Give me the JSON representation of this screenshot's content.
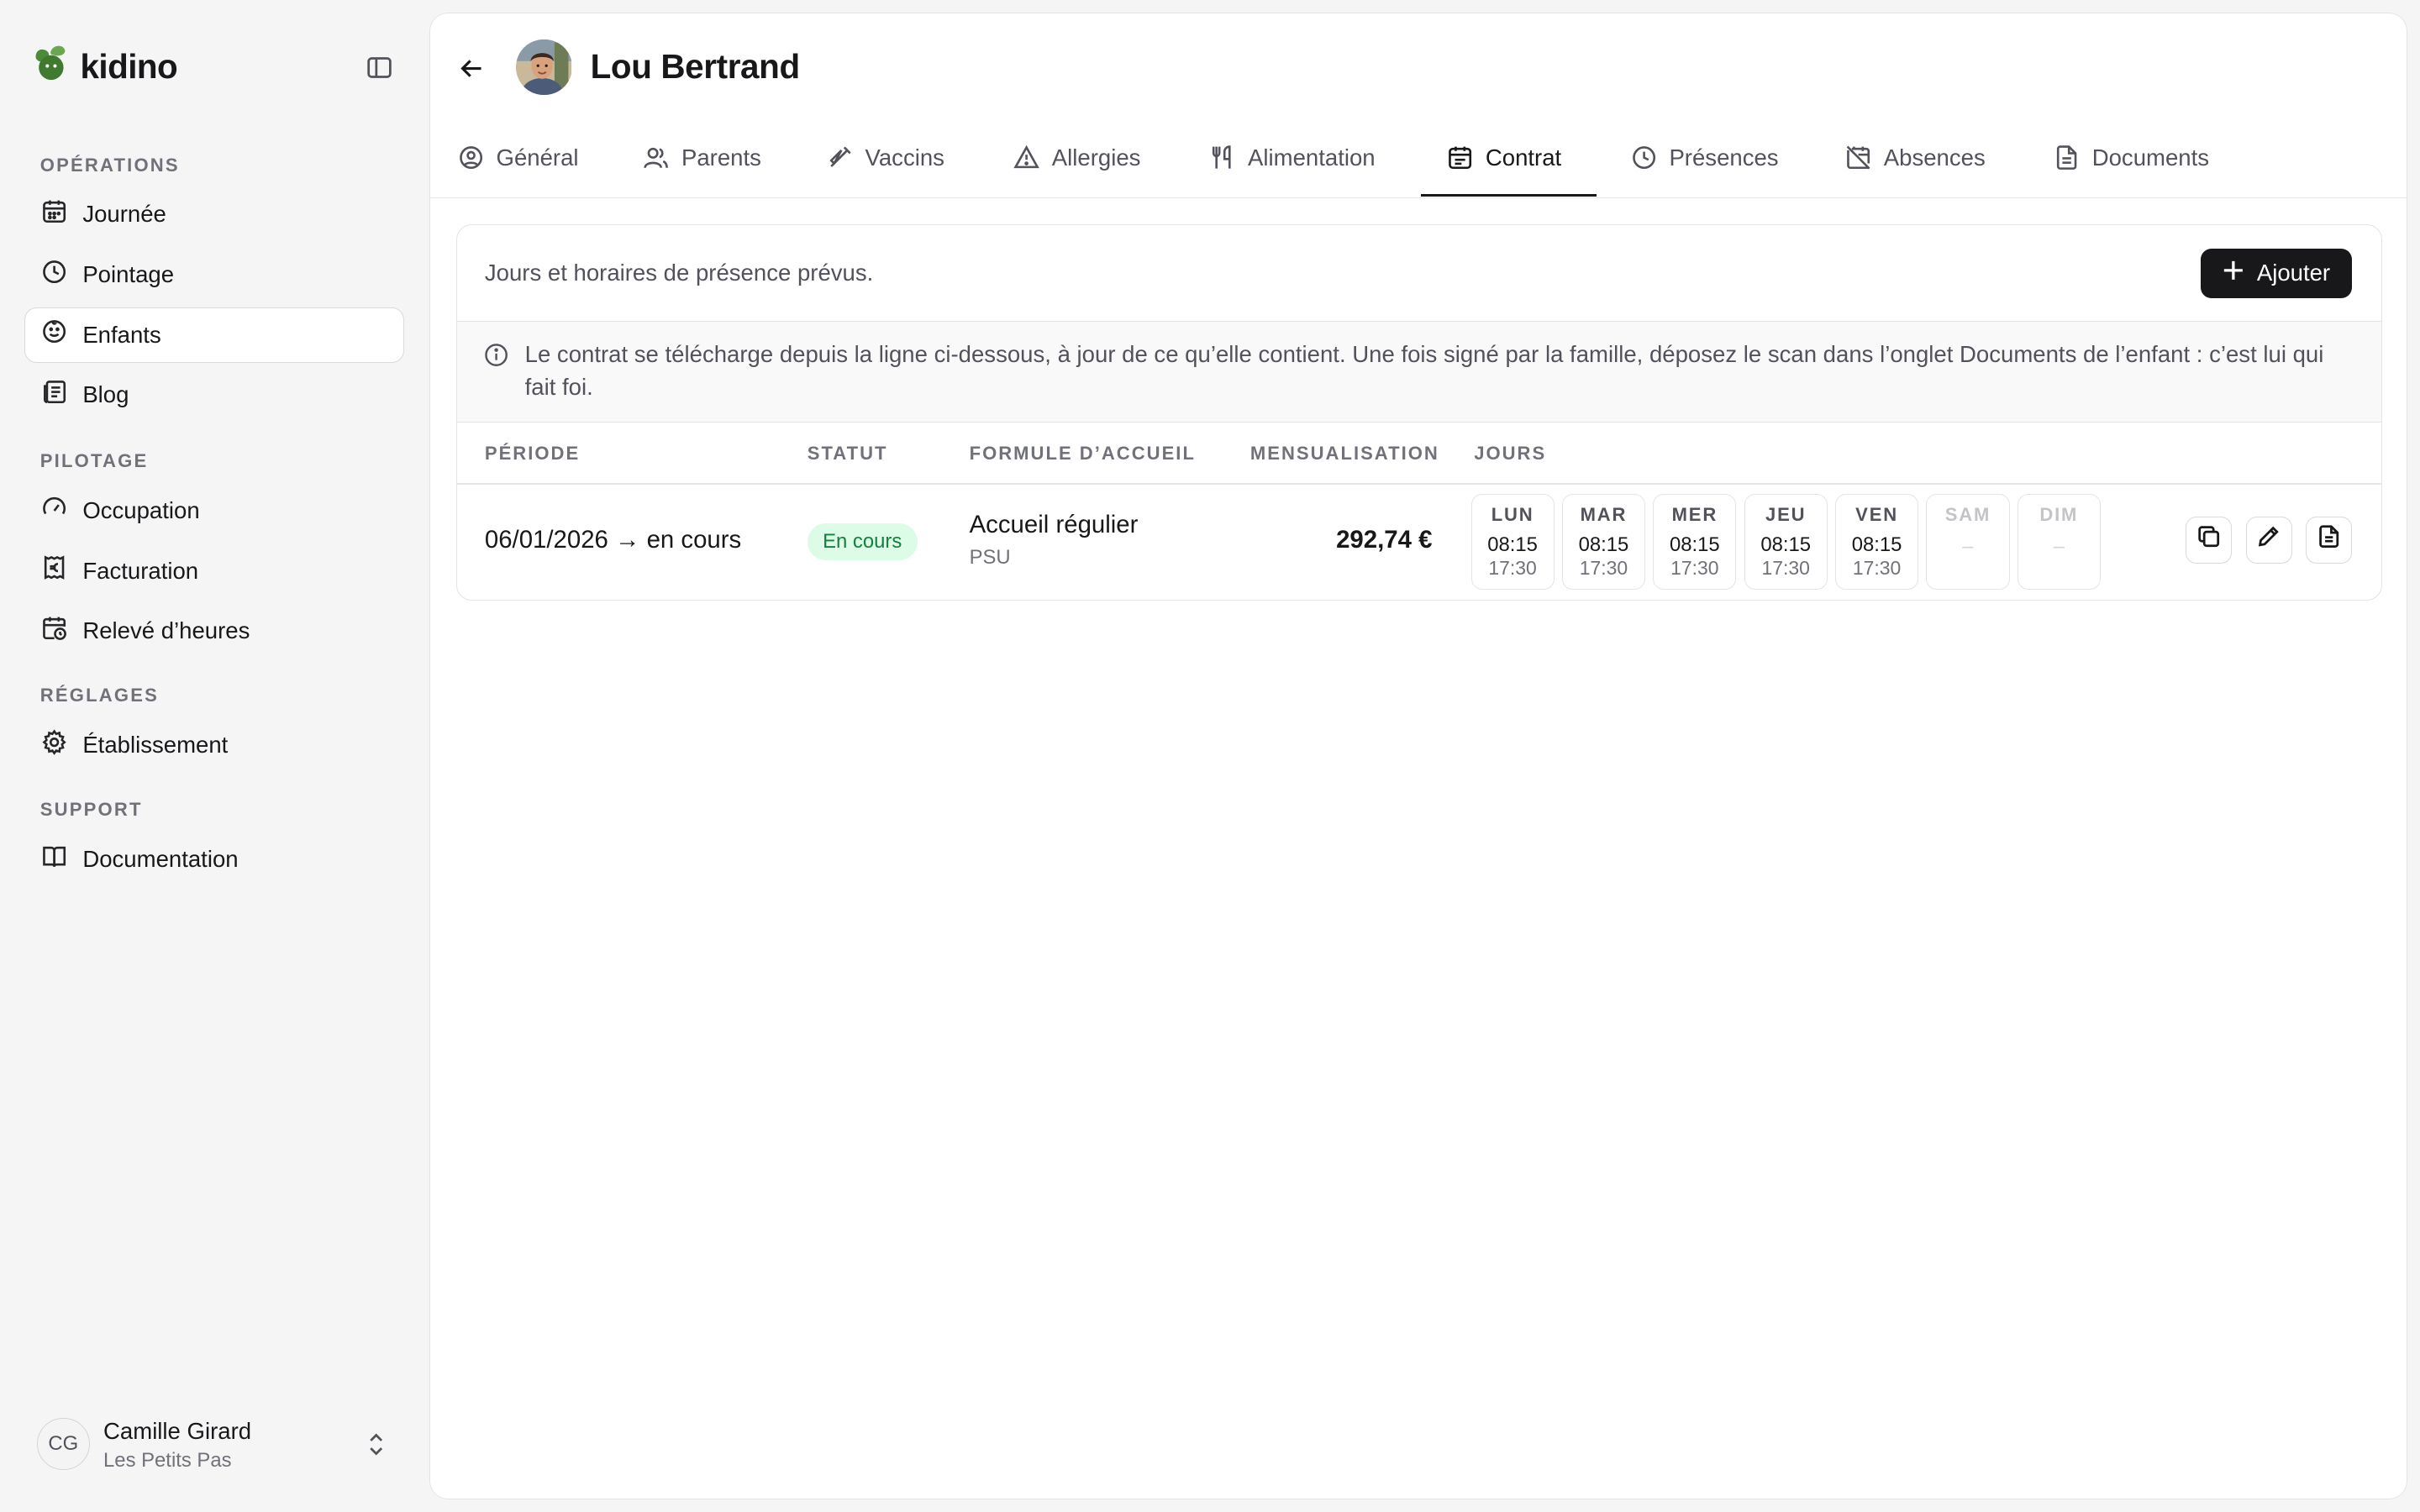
{
  "app": {
    "name": "kidino"
  },
  "sidebar": {
    "sections": [
      {
        "label": "OPÉRATIONS",
        "items": [
          {
            "label": "Journée",
            "icon": "calendar-icon"
          },
          {
            "label": "Pointage",
            "icon": "clock-icon"
          },
          {
            "label": "Enfants",
            "icon": "smile-face-icon",
            "active": true
          },
          {
            "label": "Blog",
            "icon": "newspaper-icon"
          }
        ]
      },
      {
        "label": "PILOTAGE",
        "items": [
          {
            "label": "Occupation",
            "icon": "gauge-icon"
          },
          {
            "label": "Facturation",
            "icon": "receipt-euro-icon"
          },
          {
            "label": "Relevé d’heures",
            "icon": "calendar-clock-icon"
          }
        ]
      },
      {
        "label": "RÉGLAGES",
        "items": [
          {
            "label": "Établissement",
            "icon": "gear-icon"
          }
        ]
      },
      {
        "label": "SUPPORT",
        "items": [
          {
            "label": "Documentation",
            "icon": "book-open-icon"
          }
        ]
      }
    ],
    "user": {
      "initials": "CG",
      "name": "Camille Girard",
      "org": "Les Petits Pas"
    }
  },
  "header": {
    "child_name": "Lou Bertrand"
  },
  "tabs": [
    {
      "label": "Général",
      "icon": "user-circle-icon"
    },
    {
      "label": "Parents",
      "icon": "users-icon"
    },
    {
      "label": "Vaccins",
      "icon": "syringe-icon"
    },
    {
      "label": "Allergies",
      "icon": "warning-triangle-icon"
    },
    {
      "label": "Alimentation",
      "icon": "utensils-icon"
    },
    {
      "label": "Contrat",
      "icon": "calendar-check-icon",
      "active": true
    },
    {
      "label": "Présences",
      "icon": "clock-icon"
    },
    {
      "label": "Absences",
      "icon": "calendar-off-icon"
    },
    {
      "label": "Documents",
      "icon": "file-text-icon"
    }
  ],
  "contract": {
    "description": "Jours et horaires de présence prévus.",
    "add_label": "Ajouter",
    "notice": "Le contrat se télécharge depuis la ligne ci-dessous, à jour de ce qu’elle contient. Une fois signé par la famille, déposez le scan dans l’onglet Documents de l’enfant : c’est lui qui fait foi.",
    "columns": {
      "period": "PÉRIODE",
      "status": "STATUT",
      "formula": "FORMULE D’ACCUEIL",
      "monthly": "MENSUALISATION",
      "days": "JOURS"
    },
    "row": {
      "period": "06/01/2026 → en cours",
      "status": "En cours",
      "formula": "Accueil régulier",
      "formula_sub": "PSU",
      "monthly": "292,74 €",
      "days": [
        {
          "name": "LUN",
          "in": "08:15",
          "out": "17:30"
        },
        {
          "name": "MAR",
          "in": "08:15",
          "out": "17:30"
        },
        {
          "name": "MER",
          "in": "08:15",
          "out": "17:30"
        },
        {
          "name": "JEU",
          "in": "08:15",
          "out": "17:30"
        },
        {
          "name": "VEN",
          "in": "08:15",
          "out": "17:30"
        },
        {
          "name": "SAM",
          "in": "–",
          "out": ""
        },
        {
          "name": "DIM",
          "in": "–",
          "out": ""
        }
      ]
    },
    "actions": [
      "copy-icon",
      "pencil-icon",
      "file-text-icon"
    ]
  },
  "colors": {
    "accent": "#18181b",
    "brand": "#4d8b3a",
    "status_bg": "#dcfce7",
    "status_fg": "#15803d"
  }
}
